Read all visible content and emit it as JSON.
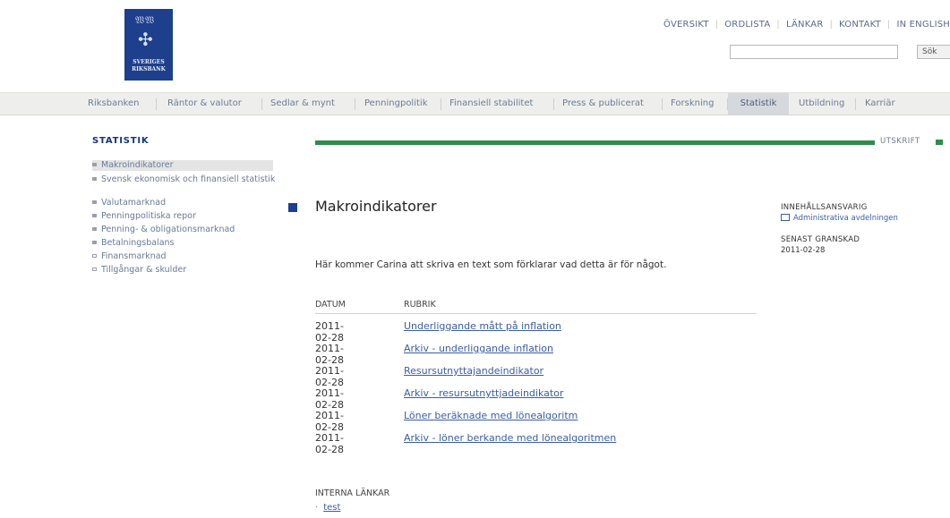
{
  "logo": {
    "crown": "𝔚𝔚",
    "line1": "SVERIGES",
    "line2": "RIKSBANK"
  },
  "top_links": [
    "ÖVERSIKT",
    "ORDLISTA",
    "LÄNKAR",
    "KONTAKT",
    "IN ENGLISH"
  ],
  "search": {
    "value": "",
    "button_label": "Sök"
  },
  "nav": {
    "items": [
      "Riksbanken",
      "Räntor & valutor",
      "Sedlar & mynt",
      "Penningpolitik",
      "Finansiell stabilitet",
      "Press & publicerat",
      "Forskning",
      "Statistik",
      "Utbildning",
      "Karriär"
    ],
    "active": "Statistik"
  },
  "sidebar": {
    "title": "STATISTIK",
    "items": [
      {
        "label": "Makroindikatorer",
        "active": true
      },
      {
        "label": "Svensk ekonomisk och finansiell statistik"
      },
      {
        "label": "Valutamarknad"
      },
      {
        "label": "Penningpolitiska repor"
      },
      {
        "label": "Penning- & obligationsmarknad"
      },
      {
        "label": "Betalningsbalans"
      },
      {
        "label": "Finansmarknad"
      },
      {
        "label": "Tillgångar & skulder"
      }
    ]
  },
  "print_label": "UTSKRIFT",
  "page": {
    "title": "Makroindikatorer",
    "intro": "Här kommer Carina att skriva en text som förklarar vad detta är för något."
  },
  "table": {
    "headers": {
      "date": "DATUM",
      "title": "RUBRIK"
    },
    "rows": [
      {
        "date": "2011-02-28",
        "title": "Underliggande mått på inflation"
      },
      {
        "date": "2011-02-28",
        "title": "Arkiv - underliggande inflation"
      },
      {
        "date": "2011-02-28",
        "title": "Resursutnyttajandeindikator"
      },
      {
        "date": "2011-02-28",
        "title": "Arkiv - resursutnyttjadeindikator"
      },
      {
        "date": "2011-02-28",
        "title": "Löner beräknade med lönealgoritm"
      },
      {
        "date": "2011-02-28",
        "title": "Arkiv - löner berkande med lönealgoritmen"
      }
    ]
  },
  "right_column": {
    "responsible_label": "INNEHÅLLSANSVARIG",
    "responsible_link": "Administrativa avdelningen",
    "reviewed_label": "SENAST GRANSKAD",
    "reviewed_date": "2011-02-28"
  },
  "internal_links": {
    "title": "INTERNA LÄNKAR",
    "items": [
      "test"
    ]
  },
  "colors": {
    "brand_blue": "#1d3f8c",
    "green_bar": "#2f8c4a",
    "link": "#3a5da8"
  }
}
